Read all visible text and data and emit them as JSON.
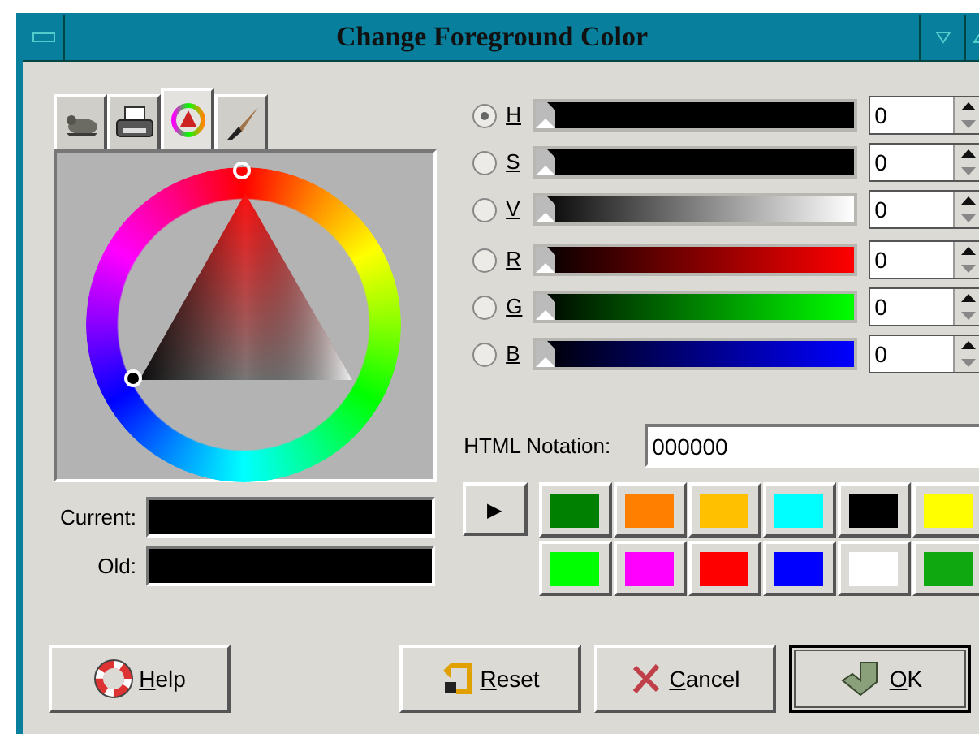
{
  "window": {
    "title": "Change Foreground Color"
  },
  "tabs": [
    {
      "kind": "creature",
      "selected": false
    },
    {
      "kind": "printer",
      "selected": false
    },
    {
      "kind": "wheel",
      "selected": true
    },
    {
      "kind": "brush",
      "selected": false
    }
  ],
  "channels": [
    {
      "label": "H",
      "selected": true,
      "level": 0,
      "value": "0",
      "color": "#000000"
    },
    {
      "label": "S",
      "selected": false,
      "level": 0,
      "value": "0",
      "color": "#000000"
    },
    {
      "label": "V",
      "selected": false,
      "level": 0,
      "value": "0",
      "color": "#ffffff"
    },
    {
      "label": "R",
      "selected": false,
      "level": 0,
      "value": "0",
      "color": "#ff0000"
    },
    {
      "label": "G",
      "selected": false,
      "level": 0,
      "value": "0",
      "color": "#00ff00"
    },
    {
      "label": "B",
      "selected": false,
      "level": 0,
      "value": "0",
      "color": "#0000ff"
    }
  ],
  "html_notation": {
    "label": "HTML Notation:",
    "value": "000000"
  },
  "current": {
    "label": "Current:",
    "color": "#000000"
  },
  "old": {
    "label": "Old:",
    "color": "#000000"
  },
  "history_button": {
    "label": "▶"
  },
  "swatches": [
    {
      "color": "#008000"
    },
    {
      "color": "#ff8000"
    },
    {
      "color": "#ffc000"
    },
    {
      "color": "#00ffff"
    },
    {
      "color": "#000000"
    },
    {
      "color": "#ffff00"
    },
    {
      "color": "#00ff00"
    },
    {
      "color": "#ff00ff"
    },
    {
      "color": "#ff0000"
    },
    {
      "color": "#0000ff"
    },
    {
      "color": "#ffffff"
    },
    {
      "color": "#10a810"
    }
  ],
  "buttons": [
    {
      "label": "Help",
      "kind": "help",
      "default": false
    },
    {
      "label": "Reset",
      "kind": "reset",
      "default": false
    },
    {
      "label": "Cancel",
      "kind": "cancel",
      "default": false
    },
    {
      "label": "OK",
      "kind": "ok",
      "default": true
    }
  ]
}
